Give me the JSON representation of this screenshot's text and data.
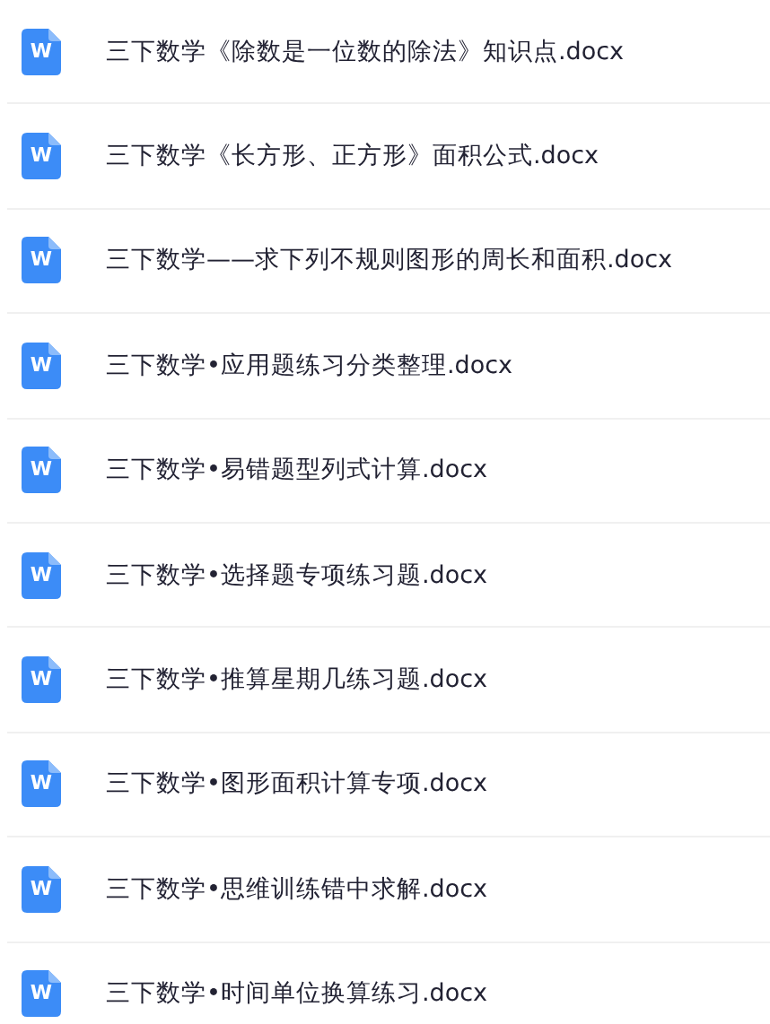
{
  "files": [
    {
      "icon_letter": "W",
      "name": "三下数学《除数是一位数的除法》知识点.docx"
    },
    {
      "icon_letter": "W",
      "name": "三下数学《长方形、正方形》面积公式.docx"
    },
    {
      "icon_letter": "W",
      "name": "三下数学——求下列不规则图形的周长和面积.docx"
    },
    {
      "icon_letter": "W",
      "name": "三下数学•应用题练习分类整理.docx"
    },
    {
      "icon_letter": "W",
      "name": "三下数学•易错题型列式计算.docx"
    },
    {
      "icon_letter": "W",
      "name": "三下数学•选择题专项练习题.docx"
    },
    {
      "icon_letter": "W",
      "name": "三下数学•推算星期几练习题.docx"
    },
    {
      "icon_letter": "W",
      "name": "三下数学•图形面积计算专项.docx"
    },
    {
      "icon_letter": "W",
      "name": "三下数学•思维训练错中求解.docx"
    },
    {
      "icon_letter": "W",
      "name": "三下数学•时间单位换算练习.docx"
    }
  ]
}
